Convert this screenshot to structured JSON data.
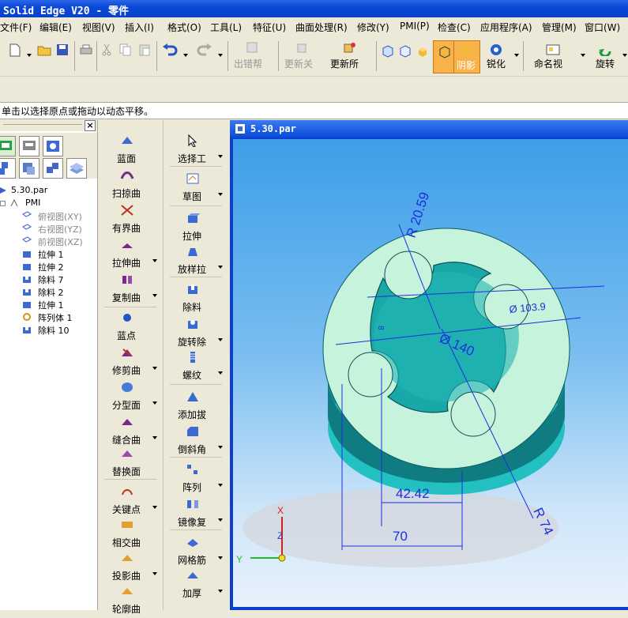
{
  "app": {
    "title": "Solid Edge V20 - 零件"
  },
  "menu": [
    "文件(F)",
    "编辑(E)",
    "视图(V)",
    "插入(I)",
    "格式(O)",
    "工具(L)",
    "特征(U)",
    "曲面处理(R)",
    "修改(Y)",
    "PMI(P)",
    "检查(C)",
    "应用程序(A)",
    "管理(M)",
    "窗口(W)"
  ],
  "toolbar": {
    "error_help": "出错帮",
    "update_related": "更新关",
    "update_all": "更新所",
    "shade": "阴影",
    "sharpen": "锐化",
    "named_view": "命名视",
    "rotate": "旋转"
  },
  "prompt": "单击以选择原点或拖动以动态平移。",
  "tree": {
    "root": "5.30.par",
    "items": [
      "PMI",
      "俯视图(XY)",
      "右视图(YZ)",
      "前视图(XZ)",
      "拉伸 1",
      "拉伸 2",
      "除料 7",
      "除料 2",
      "拉伸 1",
      "阵列体 1",
      "除料 10"
    ]
  },
  "commands_left": [
    "蓝面",
    "扫掠曲",
    "有界曲",
    "拉伸曲",
    "复制曲",
    "蓝点",
    "修剪曲",
    "分型面",
    "缝合曲",
    "替换面",
    "关键点",
    "相交曲",
    "投影曲",
    "轮廓曲"
  ],
  "commands_right": [
    "选择工",
    "草图",
    "拉伸",
    "放样拉",
    "除料",
    "旋转除",
    "螺纹",
    "添加拔",
    "倒斜角",
    "阵列",
    "镜像复",
    "网格筋",
    "加厚"
  ],
  "document": {
    "title": "5.30.par"
  },
  "dimensions": [
    "R 20.59",
    "Ø 103.9",
    "Ø 140",
    "R 74",
    "42.42",
    "70",
    "8"
  ],
  "axes": {
    "x": "X",
    "y": "Y",
    "z": "Z"
  },
  "colors": {
    "accent": "#0a48d8",
    "part_top": "#1aa7a8",
    "part_face": "#c9f1dc",
    "dim": "#1d2fe0"
  }
}
